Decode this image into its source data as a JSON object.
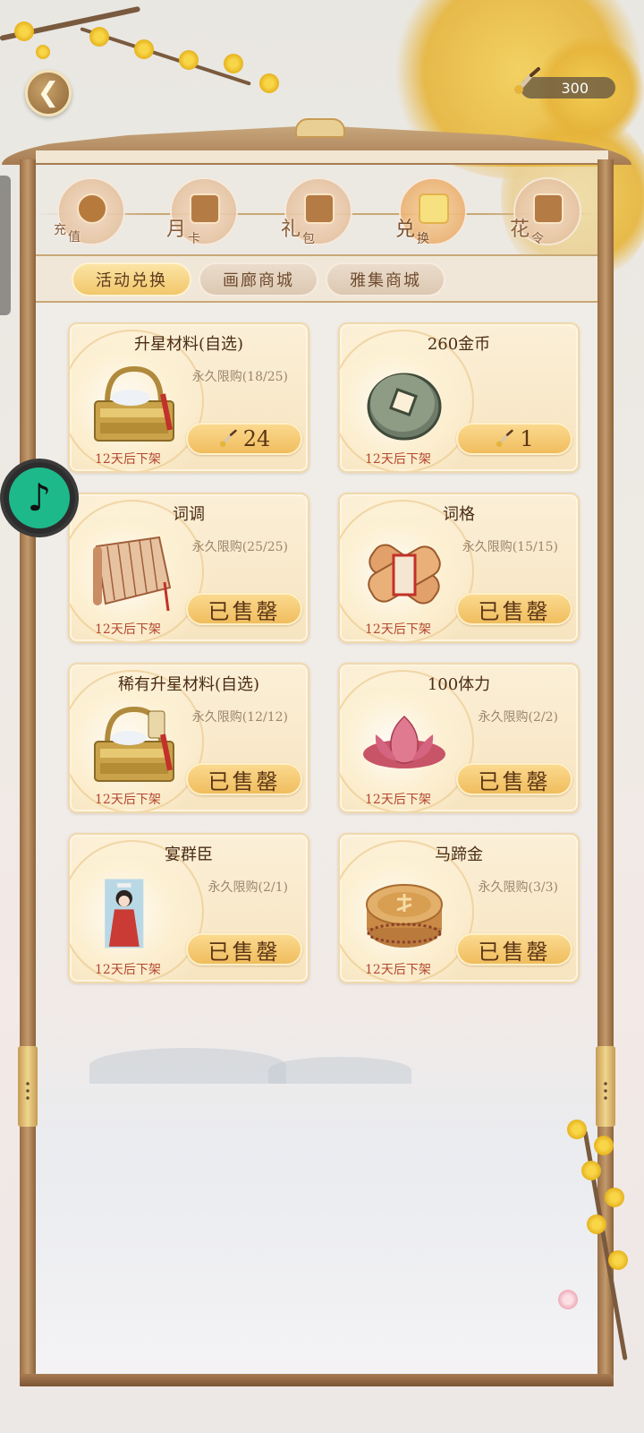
{
  "header": {
    "currency_value": "300"
  },
  "categories": [
    {
      "label1": "充",
      "label2": "值",
      "active": false
    },
    {
      "label1": "月",
      "label2": "卡",
      "active": false
    },
    {
      "label1": "礼",
      "label2": "包",
      "active": false
    },
    {
      "label1": "兑",
      "label2": "换",
      "active": true
    },
    {
      "label1": "花",
      "label2": "令",
      "active": false
    }
  ],
  "subtabs": [
    {
      "label": "活动兑换",
      "active": true
    },
    {
      "label": "画廊商城",
      "active": false
    },
    {
      "label": "雅集商城",
      "active": false
    }
  ],
  "items": [
    {
      "title": "升星材料(自选)",
      "limit": "永久限购(18/25)",
      "button": "24",
      "sold_out": false,
      "expire": "12天后下架",
      "icon": "golden-basket"
    },
    {
      "title": "260金币",
      "limit": "",
      "button": "1",
      "sold_out": false,
      "expire": "12天后下架",
      "icon": "jade-coin"
    },
    {
      "title": "词调",
      "limit": "永久限购(25/25)",
      "button": "已售罄",
      "sold_out": true,
      "expire": "12天后下架",
      "icon": "bamboo-scroll"
    },
    {
      "title": "词格",
      "limit": "永久限购(15/15)",
      "button": "已售罄",
      "sold_out": true,
      "expire": "12天后下架",
      "icon": "scroll-bundle"
    },
    {
      "title": "稀有升星材料(自选)",
      "limit": "永久限购(12/12)",
      "button": "已售罄",
      "sold_out": true,
      "expire": "12天后下架",
      "icon": "rare-basket"
    },
    {
      "title": "100体力",
      "limit": "永久限购(2/2)",
      "button": "已售罄",
      "sold_out": true,
      "expire": "12天后下架",
      "icon": "lotus"
    },
    {
      "title": "宴群臣",
      "limit": "永久限购(2/1)",
      "button": "已售罄",
      "sold_out": true,
      "expire": "12天后下架",
      "icon": "lady-portrait"
    },
    {
      "title": "马蹄金",
      "limit": "永久限购(3/3)",
      "button": "已售罄",
      "sold_out": true,
      "expire": "12天后下架",
      "icon": "gold-ingot"
    }
  ],
  "colors": {
    "accent_gold": "#f0bd5e",
    "expire_red": "#b3472f",
    "frame_brown": "#a67b52",
    "music_green": "#1db98a"
  }
}
